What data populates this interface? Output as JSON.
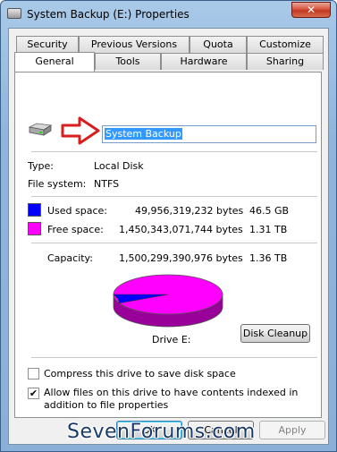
{
  "window": {
    "title": "System Backup (E:) Properties",
    "close_label": "✕"
  },
  "tabs_row1": [
    "Security",
    "Previous Versions",
    "Quota",
    "Customize"
  ],
  "tabs_row2": [
    "General",
    "Tools",
    "Hardware",
    "Sharing"
  ],
  "active_tab": "General",
  "general": {
    "drive_name": "System Backup",
    "type_label": "Type:",
    "type_value": "Local Disk",
    "fs_label": "File system:",
    "fs_value": "NTFS",
    "used_label": "Used space:",
    "used_bytes": "49,956,319,232 bytes",
    "used_size": "46.5 GB",
    "free_label": "Free space:",
    "free_bytes": "1,450,343,071,744 bytes",
    "free_size": "1.31 TB",
    "capacity_label": "Capacity:",
    "capacity_bytes": "1,500,299,390,976 bytes",
    "capacity_size": "1.36 TB",
    "drive_label": "Drive E:",
    "disk_cleanup": "Disk Cleanup",
    "compress_label": "Compress this drive to save disk space",
    "compress_checked": false,
    "index_label": "Allow files on this drive to have contents indexed in addition to file properties",
    "index_checked": true,
    "used_fraction": 0.0333
  },
  "colors": {
    "used": "#0000ff",
    "free": "#ff00ff"
  },
  "watermark": "SevenForums.com",
  "buttons": {
    "ok": "OK",
    "cancel": "Cancel",
    "apply": "Apply"
  }
}
